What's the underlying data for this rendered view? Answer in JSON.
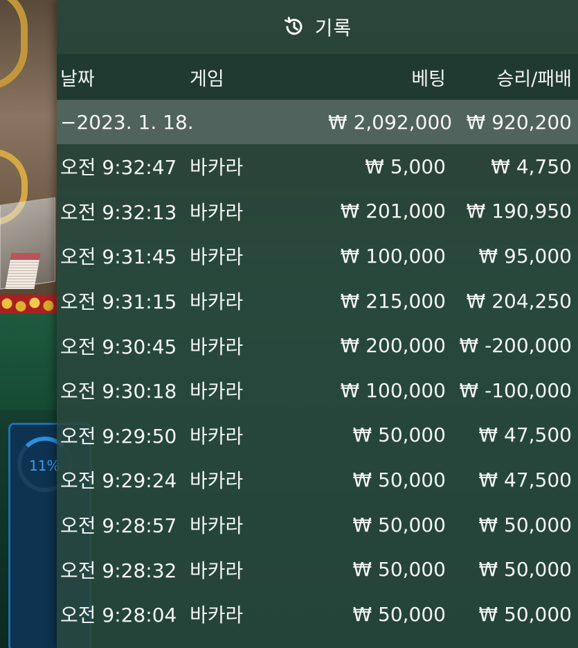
{
  "panel": {
    "title": "기록",
    "icon": "history-icon"
  },
  "columns": {
    "date": "날짜",
    "game": "게임",
    "bet": "베팅",
    "result": "승리/패배"
  },
  "summary": {
    "date": "−2023. 1. 18.",
    "bet": "₩ 2,092,000",
    "result": "₩ 920,200"
  },
  "rows": [
    {
      "time": "오전 9:32:47",
      "game": "바카라",
      "bet": "₩ 5,000",
      "result": "₩ 4,750"
    },
    {
      "time": "오전 9:32:13",
      "game": "바카라",
      "bet": "₩ 201,000",
      "result": "₩ 190,950"
    },
    {
      "time": "오전 9:31:45",
      "game": "바카라",
      "bet": "₩ 100,000",
      "result": "₩ 95,000"
    },
    {
      "time": "오전 9:31:15",
      "game": "바카라",
      "bet": "₩ 215,000",
      "result": "₩ 204,250"
    },
    {
      "time": "오전 9:30:45",
      "game": "바카라",
      "bet": "₩ 200,000",
      "result": "₩ -200,000"
    },
    {
      "time": "오전 9:30:18",
      "game": "바카라",
      "bet": "₩ 100,000",
      "result": "₩ -100,000"
    },
    {
      "time": "오전 9:29:50",
      "game": "바카라",
      "bet": "₩ 50,000",
      "result": "₩ 47,500"
    },
    {
      "time": "오전 9:29:24",
      "game": "바카라",
      "bet": "₩ 50,000",
      "result": "₩ 47,500"
    },
    {
      "time": "오전 9:28:57",
      "game": "바카라",
      "bet": "₩ 50,000",
      "result": "₩ 50,000"
    },
    {
      "time": "오전 9:28:32",
      "game": "바카라",
      "bet": "₩ 50,000",
      "result": "₩ 50,000"
    },
    {
      "time": "오전 9:28:04",
      "game": "바카라",
      "bet": "₩ 50,000",
      "result": "₩ 50,000"
    }
  ],
  "background": {
    "progress_label": "11%"
  },
  "colors": {
    "panel_bg": "#2a483e",
    "summary_bg": "#5f6e69",
    "text": "#f4f6f5",
    "progress_accent": "#2c8fe0"
  }
}
